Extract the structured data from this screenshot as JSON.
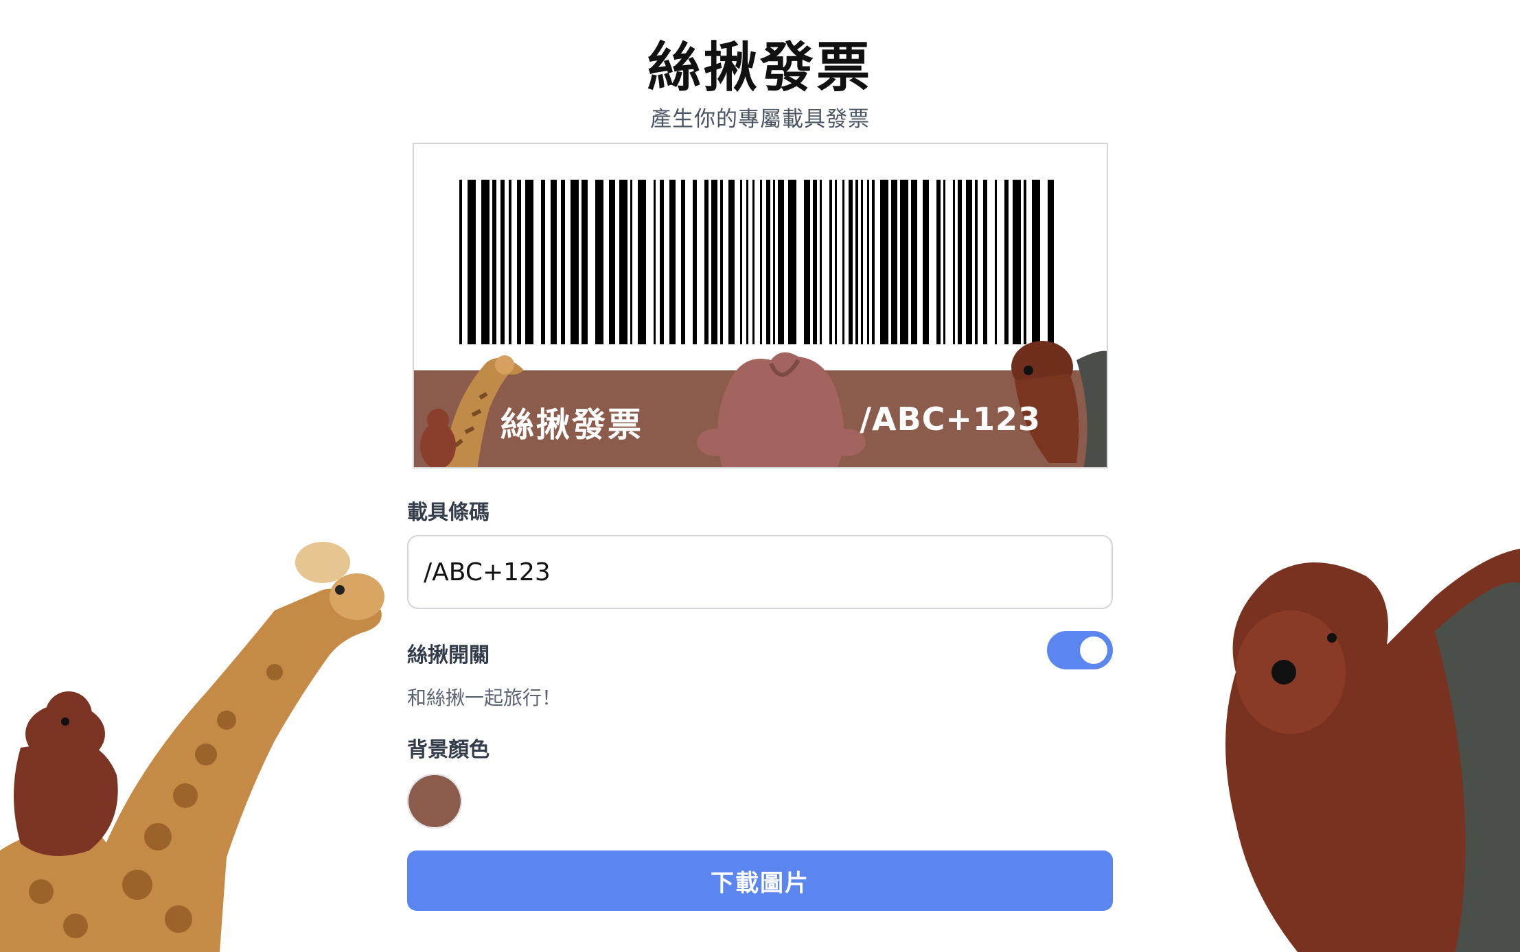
{
  "header": {
    "title": "絲揪發票",
    "subtitle": "產生你的專屬載具發票"
  },
  "preview": {
    "band_title": "絲揪發票",
    "barcode_text": "/ABC+123"
  },
  "form": {
    "barcode_label": "載具條碼",
    "barcode_value": "/ABC+123",
    "toggle_label": "絲揪開關",
    "toggle_on": true,
    "toggle_hint": "和絲揪一起旅行！",
    "color_label": "背景顏色",
    "download_label": "下載圖片"
  },
  "colors": {
    "background_color": "#8b5b4c",
    "accent": "#5b86ef"
  },
  "icons": {
    "decorations": [
      "giraffe-plush-icon",
      "bear-plush-icon",
      "bear-plush-backpack-icon"
    ]
  }
}
